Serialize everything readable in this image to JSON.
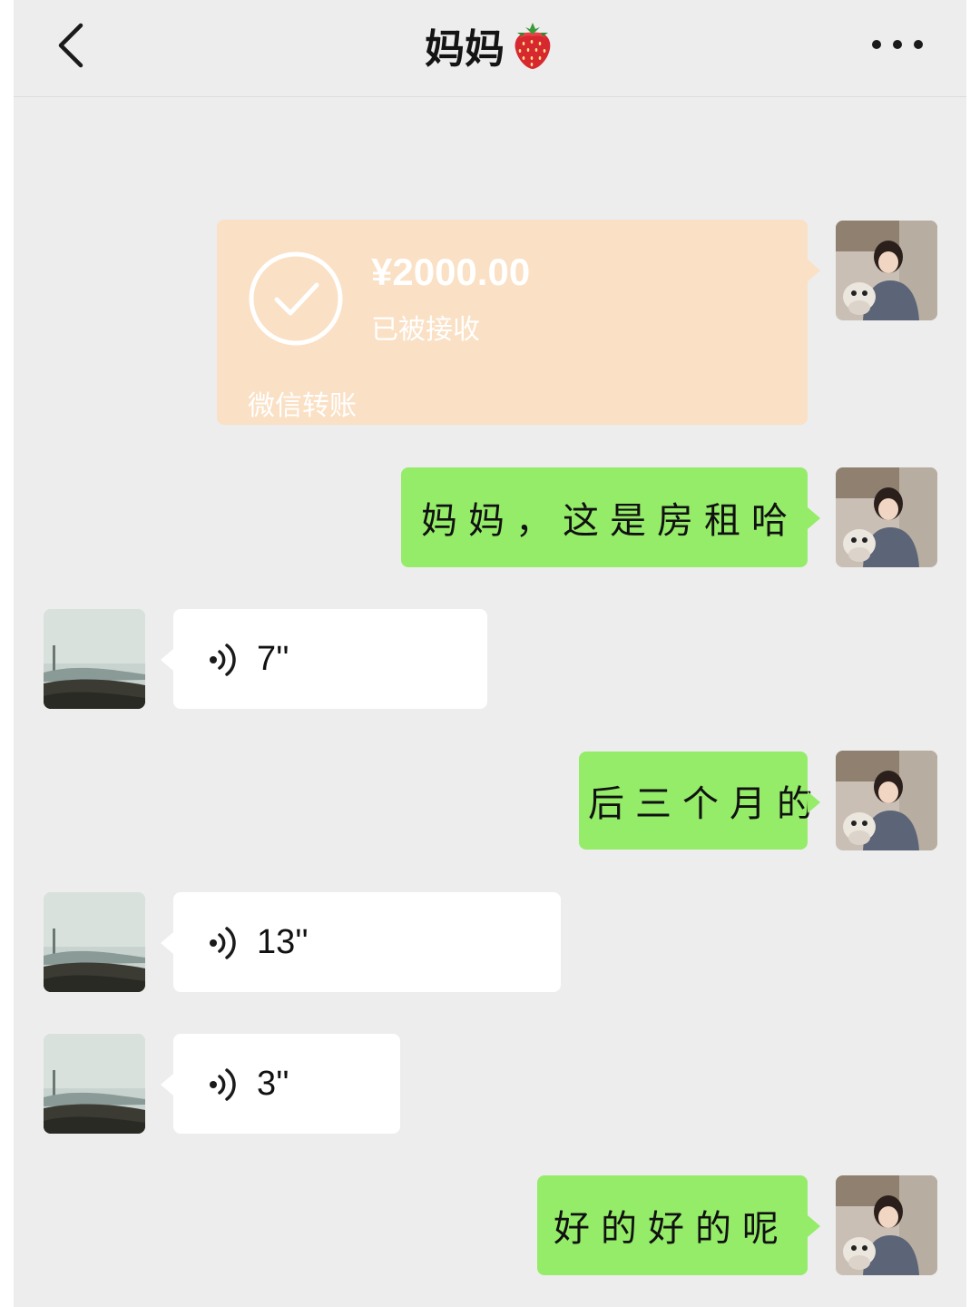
{
  "header": {
    "title": "妈妈",
    "back_icon": "chevron-left-icon",
    "title_icon": "strawberry-icon",
    "more_icon": "more-dots-icon"
  },
  "colors": {
    "background": "#ededed",
    "sent_bubble": "#95ec69",
    "received_bubble": "#ffffff",
    "transfer_card": "#fae0c4"
  },
  "messages": [
    {
      "type": "transfer",
      "sender": "me",
      "amount": "¥2000.00",
      "status": "已被接收",
      "footer": "微信转账"
    },
    {
      "type": "text",
      "sender": "me",
      "text": "妈妈，这是房租哈"
    },
    {
      "type": "voice",
      "sender": "mom",
      "duration": "7''"
    },
    {
      "type": "text",
      "sender": "me",
      "text": "后三个月的"
    },
    {
      "type": "voice",
      "sender": "mom",
      "duration": "13''"
    },
    {
      "type": "voice",
      "sender": "mom",
      "duration": "3''"
    },
    {
      "type": "text",
      "sender": "me",
      "text": "好的好的呢"
    }
  ]
}
